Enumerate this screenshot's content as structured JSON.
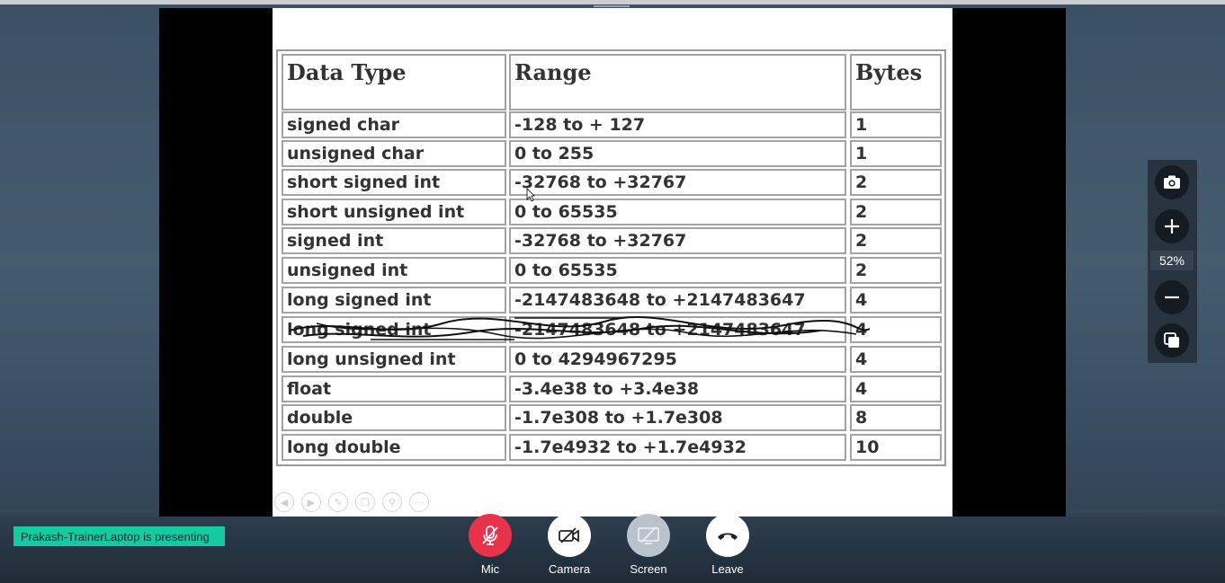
{
  "table": {
    "headers": [
      "Data Type",
      "Range",
      "Bytes"
    ],
    "rows": [
      {
        "type": "signed char",
        "range": "-128 to + 127",
        "bytes": "1"
      },
      {
        "type": "unsigned char",
        "range": "0 to 255",
        "bytes": "1"
      },
      {
        "type": "short signed int",
        "range": "-32768 to +32767",
        "bytes": "2"
      },
      {
        "type": "short unsigned int",
        "range": "0 to 65535",
        "bytes": "2"
      },
      {
        "type": "signed int",
        "range": "-32768 to +32767",
        "bytes": "2"
      },
      {
        "type": "unsigned int",
        "range": "0 to 65535",
        "bytes": "2"
      },
      {
        "type": "long signed int",
        "range": "-2147483648 to +2147483647",
        "bytes": "4"
      },
      {
        "type": "long signed int",
        "range": "-2147483648 to +2147483647",
        "bytes": "4"
      },
      {
        "type": "long unsigned int",
        "range": "0 to 4294967295",
        "bytes": "4"
      },
      {
        "type": "float",
        "range": "-3.4e38 to +3.4e38",
        "bytes": "4"
      },
      {
        "type": "double",
        "range": "-1.7e308 to +1.7e308",
        "bytes": "8"
      },
      {
        "type": "long double",
        "range": "-1.7e4932 to +1.7e4932",
        "bytes": "10"
      }
    ]
  },
  "zoom": {
    "level": "52%"
  },
  "presenting_banner": "Prakash-TrainerLaptop is presenting",
  "controls": {
    "mic_label": "Mic",
    "camera_label": "Camera",
    "screen_label": "Screen",
    "leave_label": "Leave"
  },
  "colors": {
    "mic_active": "#e8334a",
    "banner": "#17c9a0",
    "screen_btn": "#b9c3cc"
  },
  "icons": [
    "camera-snapshot-icon",
    "zoom-in-icon",
    "zoom-out-icon",
    "popout-icon",
    "mic-off-icon",
    "camera-off-icon",
    "screen-share-off-icon",
    "hang-up-icon"
  ]
}
